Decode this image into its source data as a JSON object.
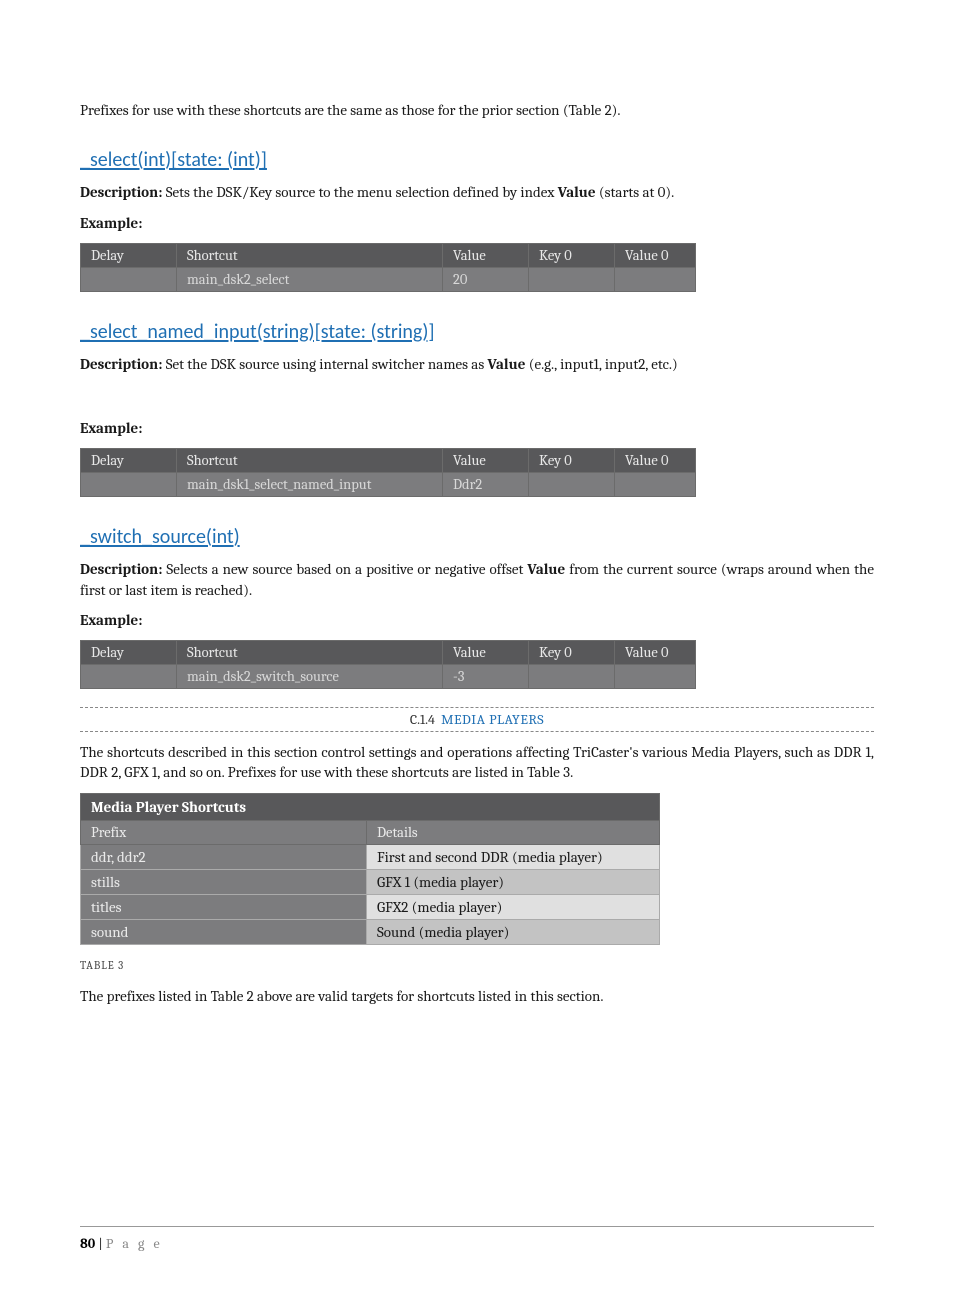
{
  "intro_text": "Prefixes for use with these shortcuts are the same as those for the prior section (Table 2).",
  "table_headers": {
    "delay": "Delay",
    "shortcut": "Shortcut",
    "value": "Value",
    "key0": "Key 0",
    "value0": "Value 0"
  },
  "select": {
    "heading": "_select(int)[state: (int)]",
    "desc_prefix": "Description:",
    "desc_text_a": " Sets the DSK/Key source to the menu selection defined by index ",
    "desc_bold": "Value",
    "desc_text_b": " (starts at 0).",
    "example_label": "Example:",
    "row": {
      "delay": "",
      "shortcut": "main_dsk2_select",
      "value": "20",
      "key0": "",
      "value0": ""
    }
  },
  "select_named": {
    "heading": "_select_named_input(string)[state: (string)]",
    "desc_prefix": "Description:",
    "desc_text_a": " Set the DSK source using internal switcher names as ",
    "desc_bold": "Value",
    "desc_text_b": " (e.g., input1, input2, etc.)",
    "example_label": "Example:",
    "row": {
      "delay": "",
      "shortcut": "main_dsk1_select_named_input",
      "value": "Ddr2",
      "key0": "",
      "value0": ""
    }
  },
  "switch_source": {
    "heading": "_switch_source(int)",
    "desc_prefix": "Description:",
    "desc_text_a": "  Selects a new source based on a positive or negative offset ",
    "desc_bold": "Value",
    "desc_text_b": " from the current source (wraps around when the first or last item is reached).",
    "example_label": "Example:",
    "row": {
      "delay": "",
      "shortcut": "main_dsk2_switch_source",
      "value": "-3",
      "key0": "",
      "value0": ""
    }
  },
  "section": {
    "num": "C.1.4",
    "title": "MEDIA PLAYERS",
    "desc": "The shortcuts described in this section control settings and operations affecting TriCaster's various Media Players, such as DDR 1, DDR 2, GFX 1, and so on. Prefixes for use with these shortcuts are listed in Table 3."
  },
  "media_table": {
    "title": "Media Player Shortcuts",
    "col_prefix": "Prefix",
    "col_details": "Details",
    "rows": [
      {
        "prefix": "ddr, ddr2",
        "details": "First and second DDR (media player)"
      },
      {
        "prefix": "stills",
        "details": "GFX 1 (media player)"
      },
      {
        "prefix": "titles",
        "details": "GFX2 (media player)"
      },
      {
        "prefix": "sound",
        "details": "Sound (media player)"
      }
    ],
    "caption": "TABLE 3"
  },
  "outro_text": "The prefixes listed in Table 2 above are valid targets for shortcuts listed in this section.",
  "footer": {
    "page_num": "80",
    "sep": " | ",
    "page_word": "P a g e"
  }
}
